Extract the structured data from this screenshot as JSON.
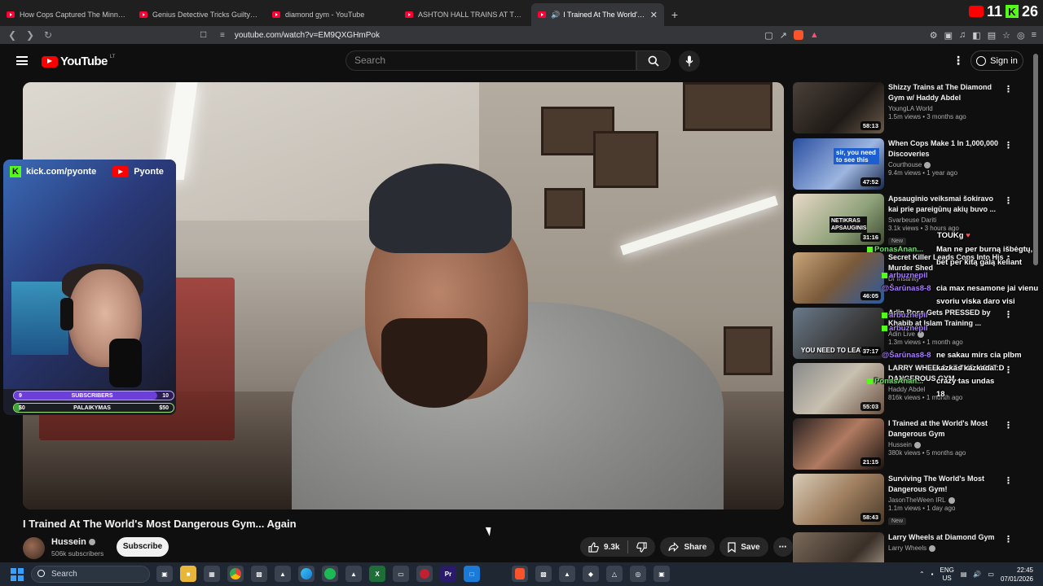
{
  "browser": {
    "tabs": [
      {
        "title": "How Cops Captured The Minnesota I"
      },
      {
        "title": "Genius Detective Tricks Guilty Suspe"
      },
      {
        "title": "diamond gym - YouTube"
      },
      {
        "title": "ASHTON HALL TRAINS AT THE MOST"
      },
      {
        "title": "I Trained At The World's Most"
      }
    ],
    "active_tab_index": 4,
    "url": "youtube.com/watch?v=EM9QXGHmPok",
    "overlay_counts": {
      "youtube": "11",
      "kick": "26"
    }
  },
  "youtube": {
    "logo_text": "YouTube",
    "country_code": "LT",
    "search_placeholder": "Search",
    "sign_in_label": "Sign in",
    "accent_color": "#ff0000"
  },
  "stream_overlay": {
    "kick_handle": "kick.com/pyonte",
    "youtube_handle": "Pyonte",
    "subscribers_bar": {
      "label": "SUBSCRIBERS",
      "current": "9",
      "goal": "10",
      "progress": 0.9
    },
    "support_bar": {
      "label": "PALAIKYMAS",
      "current": "$0",
      "goal": "$50",
      "progress": 0.04
    }
  },
  "video": {
    "title": "I Trained At The World's Most Dangerous Gym... Again",
    "channel": "Hussein",
    "subscribers": "506k subscribers",
    "subscribe_label": "Subscribe",
    "likes": "9.3k",
    "share_label": "Share",
    "save_label": "Save"
  },
  "sidebar": [
    {
      "title": "Shizzy Trains at The Diamond Gym w/ Haddy Abdel",
      "channel": "YoungLA World",
      "meta": "1.5m views • 3 months ago",
      "duration": "58:13",
      "verified": false,
      "badge": ""
    },
    {
      "title": "When Cops Make 1 In 1,000,000 Discoveries",
      "channel": "Courthouse",
      "meta": "9.4m views • 1 year ago",
      "duration": "47:52",
      "verified": true,
      "badge": "",
      "thumb_text": "sir, you need to see this"
    },
    {
      "title": "Apsauginio veiksmai šokiravo kai prie pareigūnų akių buvo ...",
      "channel": "Svarbeuse Dariti",
      "meta": "3.1k views • 3 hours ago",
      "duration": "31:16",
      "verified": false,
      "badge": "New",
      "thumb_text": "NETIKRAS APSAUGINIS"
    },
    {
      "title": "Secret Killer Leads Cops Into His Murder Shed",
      "channel": "Dr Insanity",
      "meta": "",
      "duration": "46:05",
      "verified": false,
      "badge": ""
    },
    {
      "title": "Adin Ross Gets PRESSED by Khabib at Islam Training ...",
      "channel": "Adin Live",
      "meta": "1.3m views • 1 month ago",
      "duration": "37:17",
      "verified": true,
      "badge": "",
      "thumb_text": "YOU NEED TO LEAVE"
    },
    {
      "title": "LARRY WHEELS AT THE MOST DANGEROUS GYM...",
      "channel": "Haddy Abdel",
      "meta": "816k views • 1 month ago",
      "duration": "55:03",
      "verified": false,
      "badge": ""
    },
    {
      "title": "I Trained at the World's Most Dangerous Gym",
      "channel": "Hussein",
      "meta": "380k views • 5 months ago",
      "duration": "21:15",
      "verified": true,
      "badge": ""
    },
    {
      "title": "Surviving The World's Most Dangerous Gym!",
      "channel": "JasonTheWeen IRL",
      "meta": "1.1m views • 1 day ago",
      "duration": "58:43",
      "verified": true,
      "badge": "New"
    },
    {
      "title": "Larry Wheels at Diamond Gym",
      "channel": "Larry Wheels",
      "meta": "",
      "duration": "",
      "verified": true,
      "badge": ""
    }
  ],
  "chat": [
    {
      "user": "",
      "text": "TOUKg"
    },
    {
      "user": "PonasAnan...",
      "text": "Man ne per burną išbėgtų,"
    },
    {
      "user": "",
      "text": "bet per kitą galą keliant"
    },
    {
      "user": "arbuznepil",
      "text": ""
    },
    {
      "user": "@Šarūnas8-8",
      "text": "cia max nesamone jai vienu"
    },
    {
      "user": "",
      "text": "svoriu viska daro visi"
    },
    {
      "user": "arbuznepil",
      "text": ""
    },
    {
      "user": "arbuznepil",
      "text": ""
    },
    {
      "user": "@Šarūnas8-8",
      "text": "ne sakau mirs cia plbm"
    },
    {
      "user": "",
      "text": "kazkas kazkada :D"
    },
    {
      "user": "PonasAnan...",
      "text": "crazy tas undas"
    },
    {
      "user": "",
      "text": "18"
    }
  ],
  "taskbar": {
    "search_placeholder": "Search",
    "lang": "ENG",
    "region": "US",
    "time": "22:45",
    "date": "07/01/2026"
  }
}
